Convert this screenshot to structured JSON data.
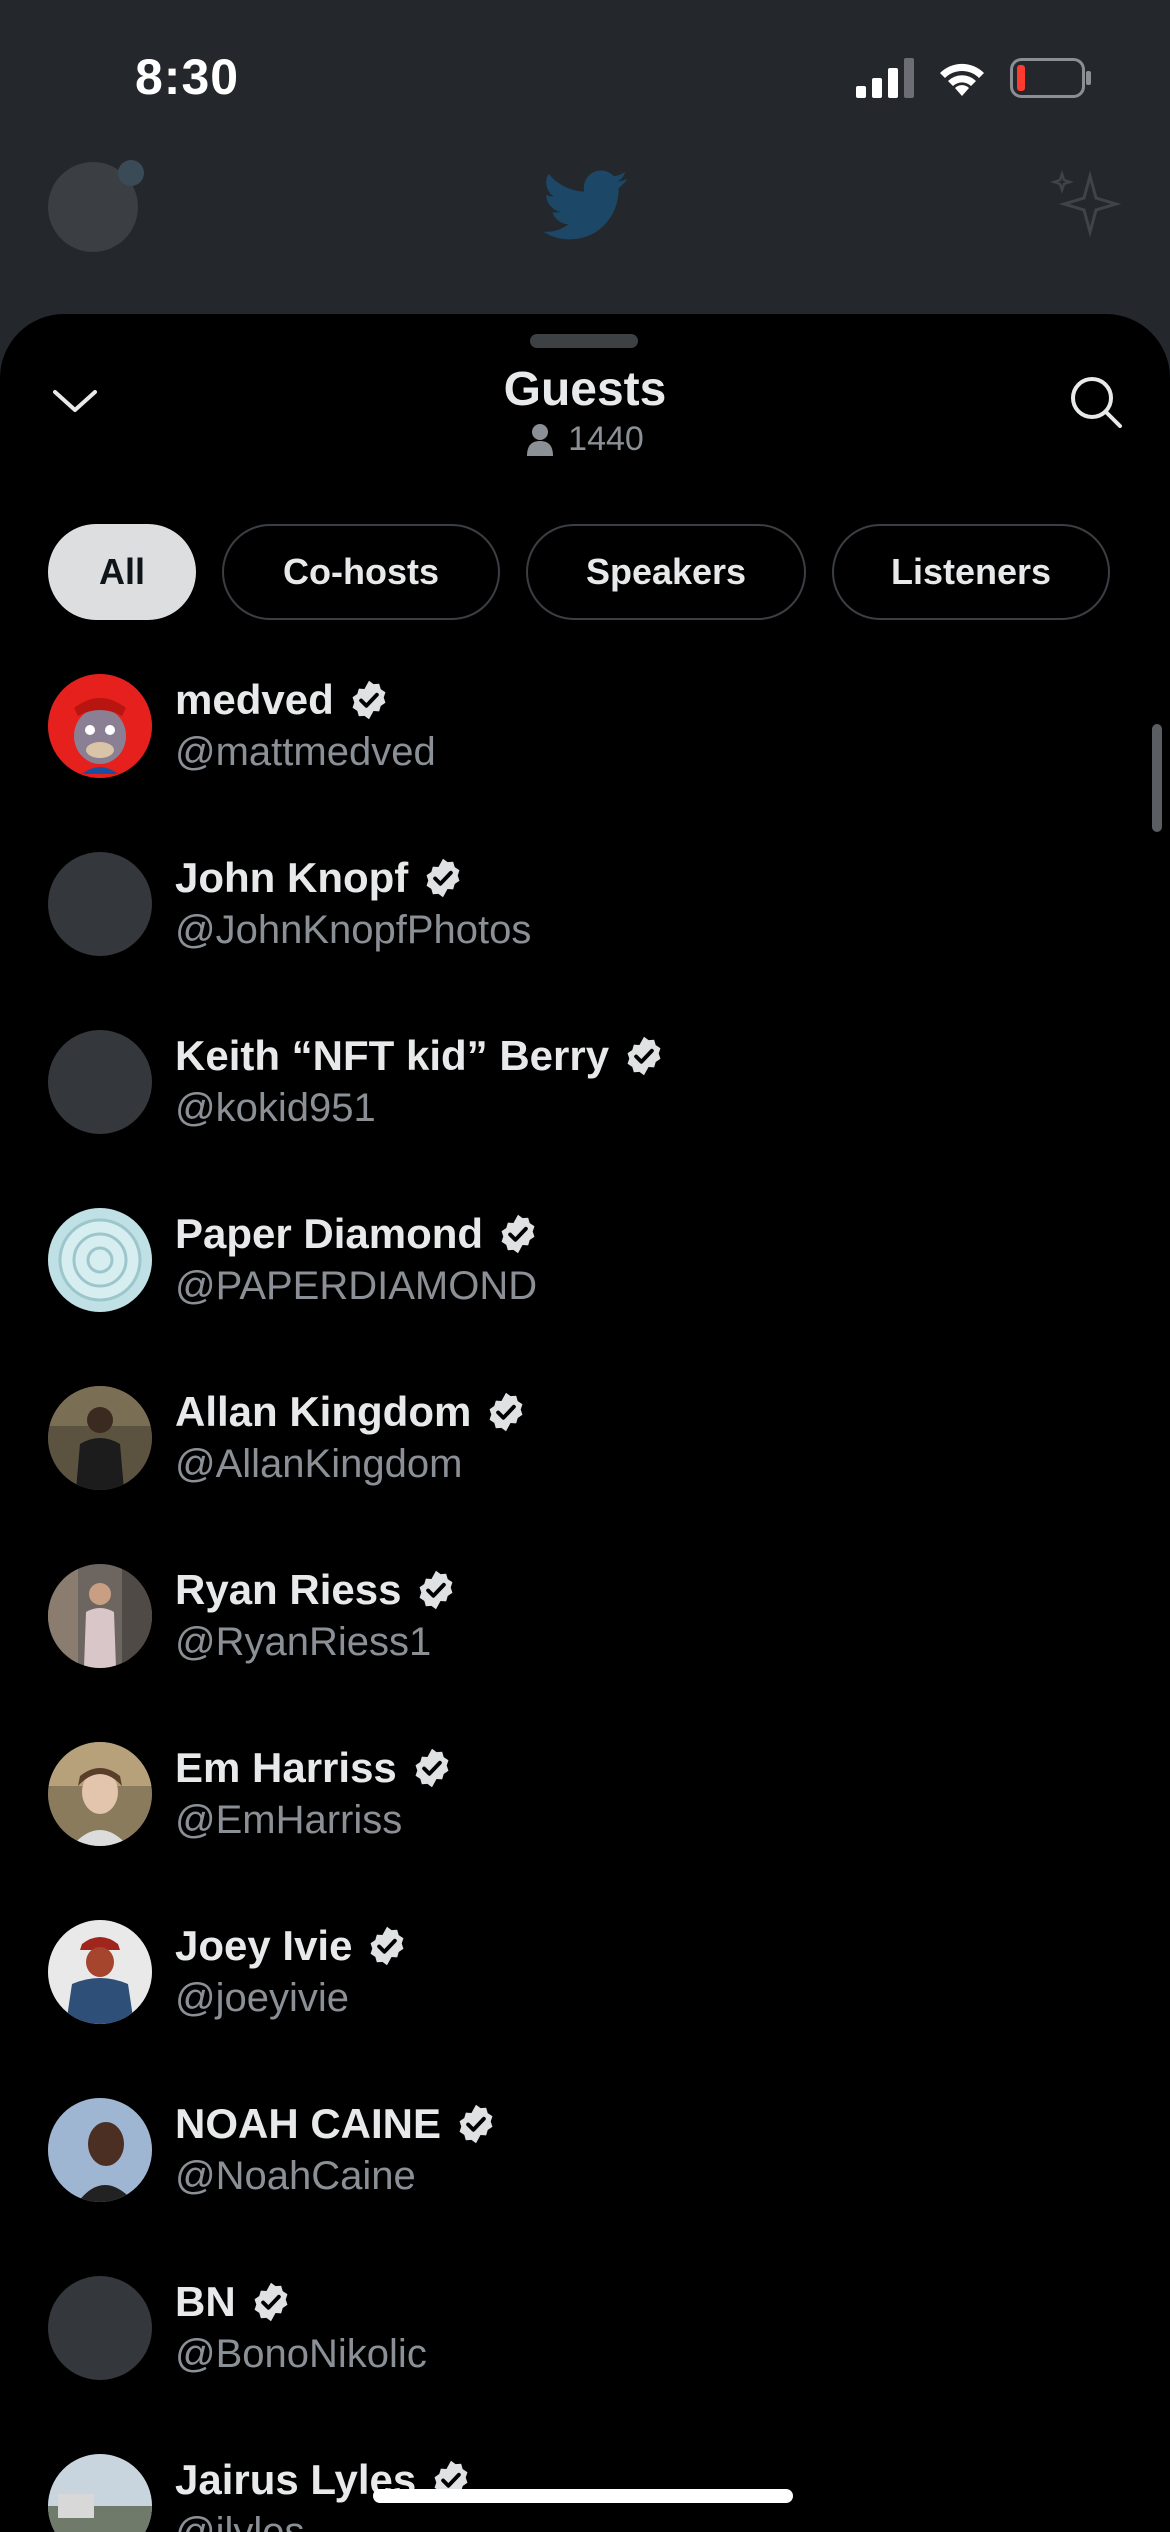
{
  "status_bar": {
    "time": "8:30",
    "battery_level": "low",
    "signal": "4 bars",
    "wifi": "on"
  },
  "background_nav": {
    "logo_icon": "twitter-bird-icon",
    "sparkle_icon": "sparkle-icon"
  },
  "sheet": {
    "title": "Guests",
    "count": "1440",
    "collapse_icon": "chevron-down-icon",
    "search_icon": "search-icon"
  },
  "tabs": [
    {
      "label": "All",
      "active": true
    },
    {
      "label": "Co-hosts",
      "active": false
    },
    {
      "label": "Speakers",
      "active": false
    },
    {
      "label": "Listeners",
      "active": false
    }
  ],
  "guests": [
    {
      "name": "medved",
      "handle": "@mattmedved",
      "verified": true,
      "avatar": "ape"
    },
    {
      "name": "John Knopf",
      "handle": "@JohnKnopfPhotos",
      "verified": true,
      "avatar": "blank"
    },
    {
      "name": "Keith “NFT kid” Berry",
      "handle": "@kokid951",
      "verified": true,
      "avatar": "blank"
    },
    {
      "name": "Paper Diamond",
      "handle": "@PAPERDIAMOND",
      "verified": true,
      "avatar": "diamond"
    },
    {
      "name": "Allan Kingdom",
      "handle": "@AllanKingdom",
      "verified": true,
      "avatar": "photo"
    },
    {
      "name": "Ryan Riess",
      "handle": "@RyanRiess1",
      "verified": true,
      "avatar": "photo"
    },
    {
      "name": "Em Harriss",
      "handle": "@EmHarriss",
      "verified": true,
      "avatar": "photo"
    },
    {
      "name": "Joey Ivie",
      "handle": "@joeyivie",
      "verified": true,
      "avatar": "photo"
    },
    {
      "name": "NOAH CAINE",
      "handle": "@NoahCaine",
      "verified": true,
      "avatar": "photo"
    },
    {
      "name": "BN",
      "handle": "@BonoNikolic",
      "verified": true,
      "avatar": "blank"
    },
    {
      "name": "Jairus Lyles",
      "handle": "@jlyles",
      "verified": true,
      "avatar": "photo"
    }
  ]
}
